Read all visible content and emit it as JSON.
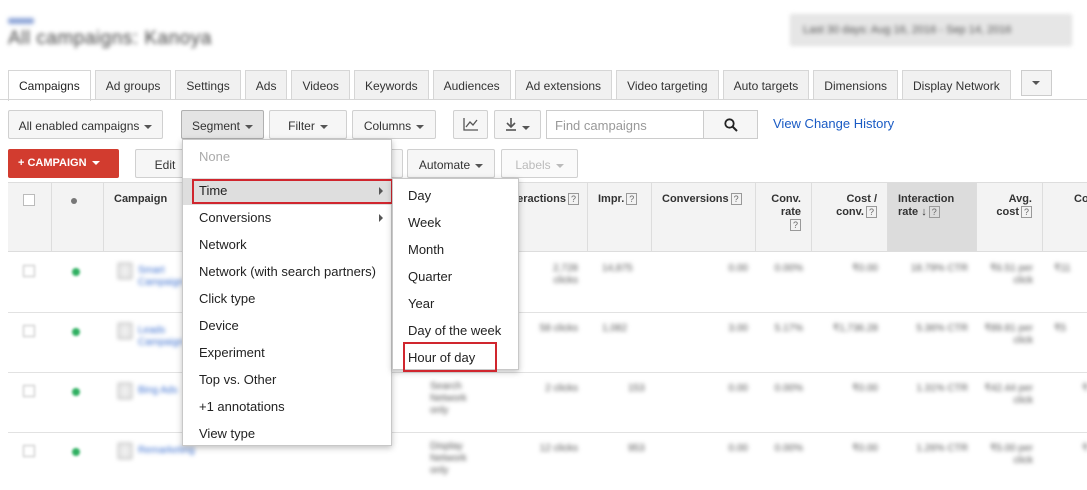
{
  "header": {
    "title": "All campaigns: Kanoya",
    "date_range": "Last 30 days: Aug 16, 2016 - Sep 14, 2016"
  },
  "tabs": [
    "Campaigns",
    "Ad groups",
    "Settings",
    "Ads",
    "Videos",
    "Keywords",
    "Audiences",
    "Ad extensions",
    "Video targeting",
    "Auto targets",
    "Dimensions",
    "Display Network"
  ],
  "toolbar": {
    "filter_select": "All enabled campaigns",
    "segment": "Segment",
    "filter": "Filter",
    "columns": "Columns",
    "search_placeholder": "Find campaigns",
    "view_change_history": "View Change History"
  },
  "toolbar2": {
    "add_campaign": "+ CAMPAIGN",
    "edit": "Edit",
    "automate": "Automate",
    "labels": "Labels"
  },
  "table": {
    "headers": {
      "campaign": "Campaign",
      "interactions": "Interactions",
      "impr": "Impr.",
      "conversions": "Conversions",
      "conv_rate": "Conv. rate",
      "cost_conv": "Cost / conv.",
      "interaction_rate": "Interaction rate",
      "avg_cost": "Avg. cost",
      "co": "Co"
    },
    "rows": [
      {
        "name": "Smart Campaign",
        "interactions": "2,728 clicks",
        "impr": "14,875",
        "conversions": "0.00",
        "conv_rate": "0.00%",
        "cost_conv": "₹0.00",
        "interaction_rate": "18.79% CTR",
        "avg_cost": "₹6.51 per click",
        "co": "₹11"
      },
      {
        "name": "Leads Campaign",
        "interactions": "58 clicks",
        "impr": "1,082",
        "conversions": "3.00",
        "conv_rate": "5.17%",
        "cost_conv": "₹1,736.28",
        "interaction_rate": "5.36% CTR",
        "avg_cost": "₹89.81 per click",
        "co": "₹5"
      },
      {
        "name": "Bing Ads",
        "network": "Search Network only",
        "interactions": "2 clicks",
        "impr": "153",
        "conversions": "0.00",
        "conv_rate": "0.00%",
        "cost_conv": "₹0.00",
        "interaction_rate": "1.31% CTR",
        "avg_cost": "₹42.44 per click",
        "co": "₹"
      },
      {
        "name": "Remarketing",
        "network": "Display Network only",
        "interactions": "12 clicks",
        "impr": "953",
        "conversions": "0.00",
        "conv_rate": "0.00%",
        "cost_conv": "₹0.00",
        "interaction_rate": "1.26% CTR",
        "avg_cost": "₹5.00 per click",
        "co": "₹"
      }
    ]
  },
  "segment_menu": {
    "items": [
      "None",
      "Time",
      "Conversions",
      "Network",
      "Network (with search partners)",
      "Click type",
      "Device",
      "Experiment",
      "Top vs. Other",
      "+1 annotations",
      "View type"
    ]
  },
  "time_submenu": {
    "items": [
      "Day",
      "Week",
      "Month",
      "Quarter",
      "Year",
      "Day of the week",
      "Hour of day"
    ]
  },
  "colors": {
    "accent_red": "#d23c2f",
    "link_blue": "#1a5bc4",
    "highlight_red": "#d0262e"
  }
}
